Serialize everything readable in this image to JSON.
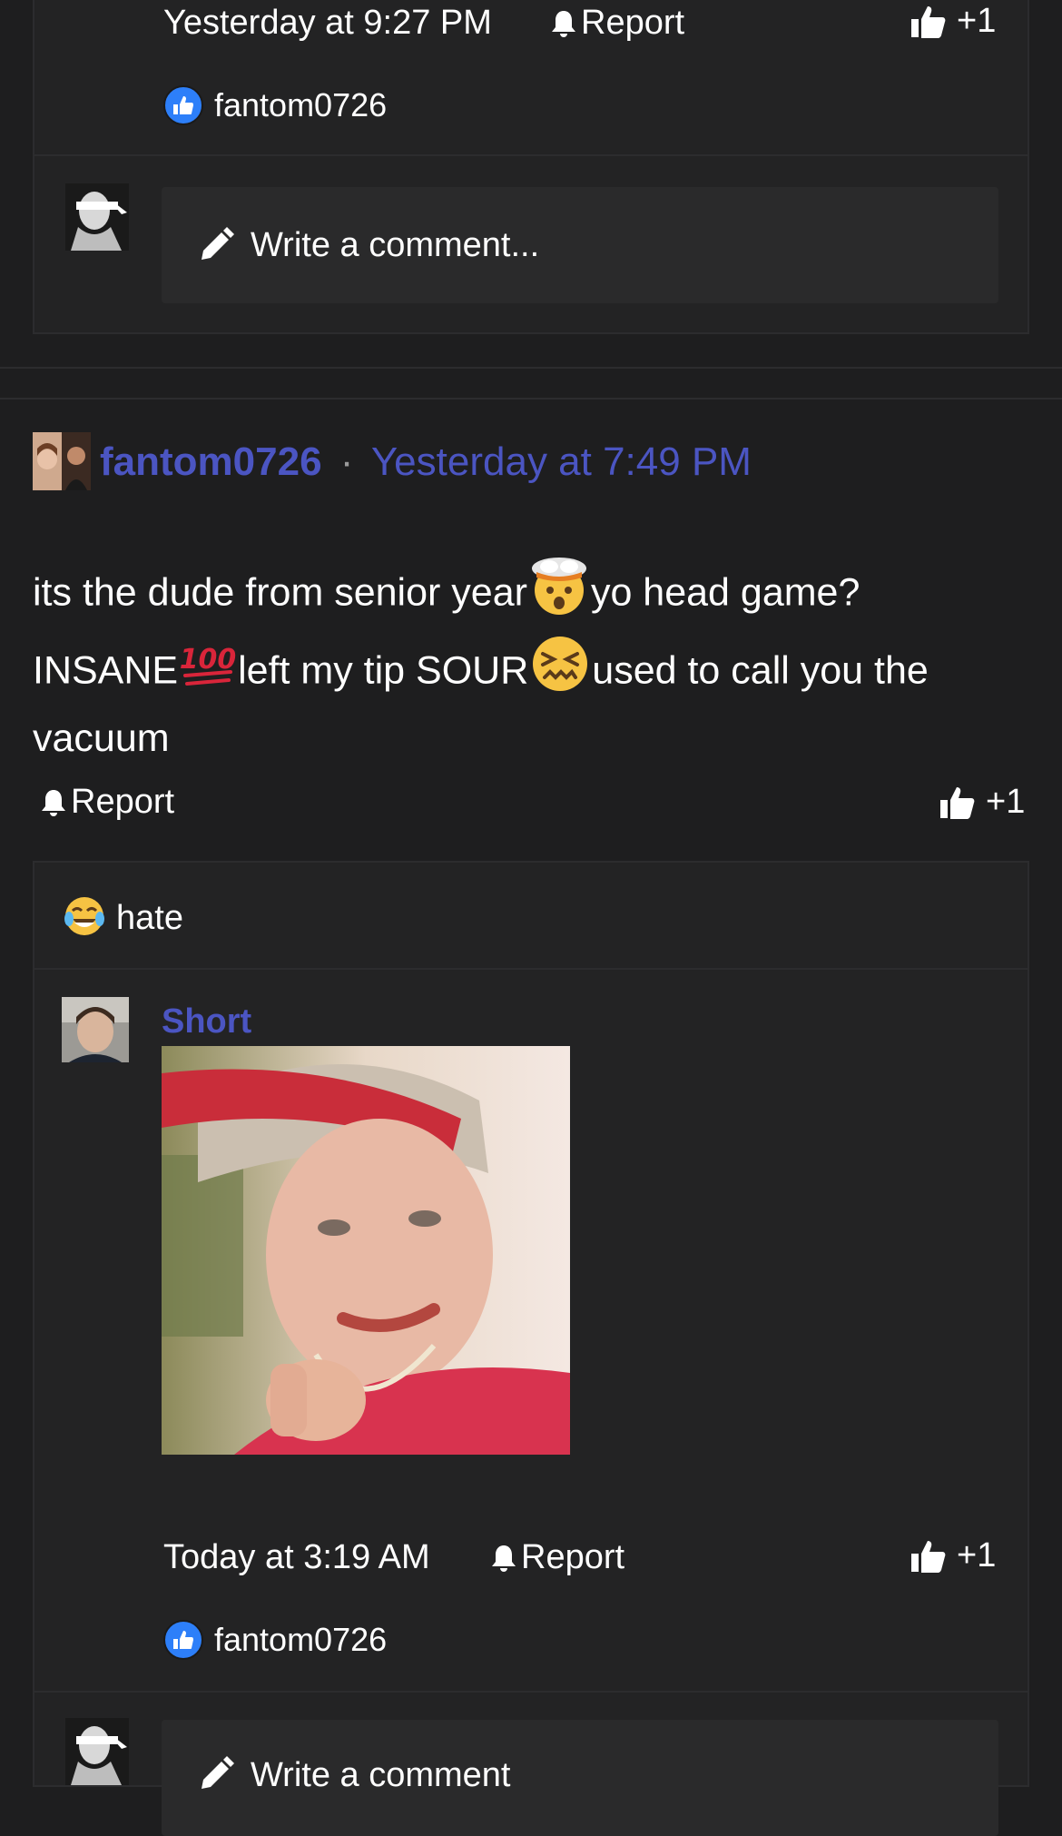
{
  "top_comment": {
    "timestamp": "Yesterday at 9:27 PM",
    "report_label": "Report",
    "like_count": "+1",
    "liker_name": "fantom0726",
    "write_placeholder": "Write a comment..."
  },
  "post": {
    "author": "fantom0726",
    "separator": "·",
    "timestamp": "Yesterday at 7:49 PM",
    "body_line1_a": "its the dude from senior year",
    "body_line1_b": "yo head game?",
    "body_line2_a": "INSANE",
    "body_line2_b": "left my tip SOUR",
    "body_line2_c": "used to call you the",
    "body_line3": "vacuum",
    "report_label": "Report",
    "like_count": "+1"
  },
  "reply_thread": {
    "reaction_text": "hate",
    "reply": {
      "author": "Short",
      "timestamp": "Today at 3:19 AM",
      "report_label": "Report",
      "like_count": "+1",
      "liker_name": "fantom0726",
      "write_placeholder": "Write a comment"
    }
  },
  "colors": {
    "background": "#1e1e1f",
    "panel": "#232324",
    "input": "#2a2a2b",
    "accent_link": "#4b55c2",
    "text": "#ffffff",
    "like_badge": "#2d7ff9"
  },
  "icons": {
    "bell": "bell-icon",
    "thumb": "thumbs-up-icon",
    "like_badge": "like-badge-icon",
    "pencil": "pencil-icon",
    "emoji_exploding_head": "exploding-head-emoji",
    "emoji_hundred": "hundred-points-emoji",
    "emoji_confounded": "confounded-face-emoji",
    "emoji_crying_laughing": "crying-laughing-emoji"
  }
}
